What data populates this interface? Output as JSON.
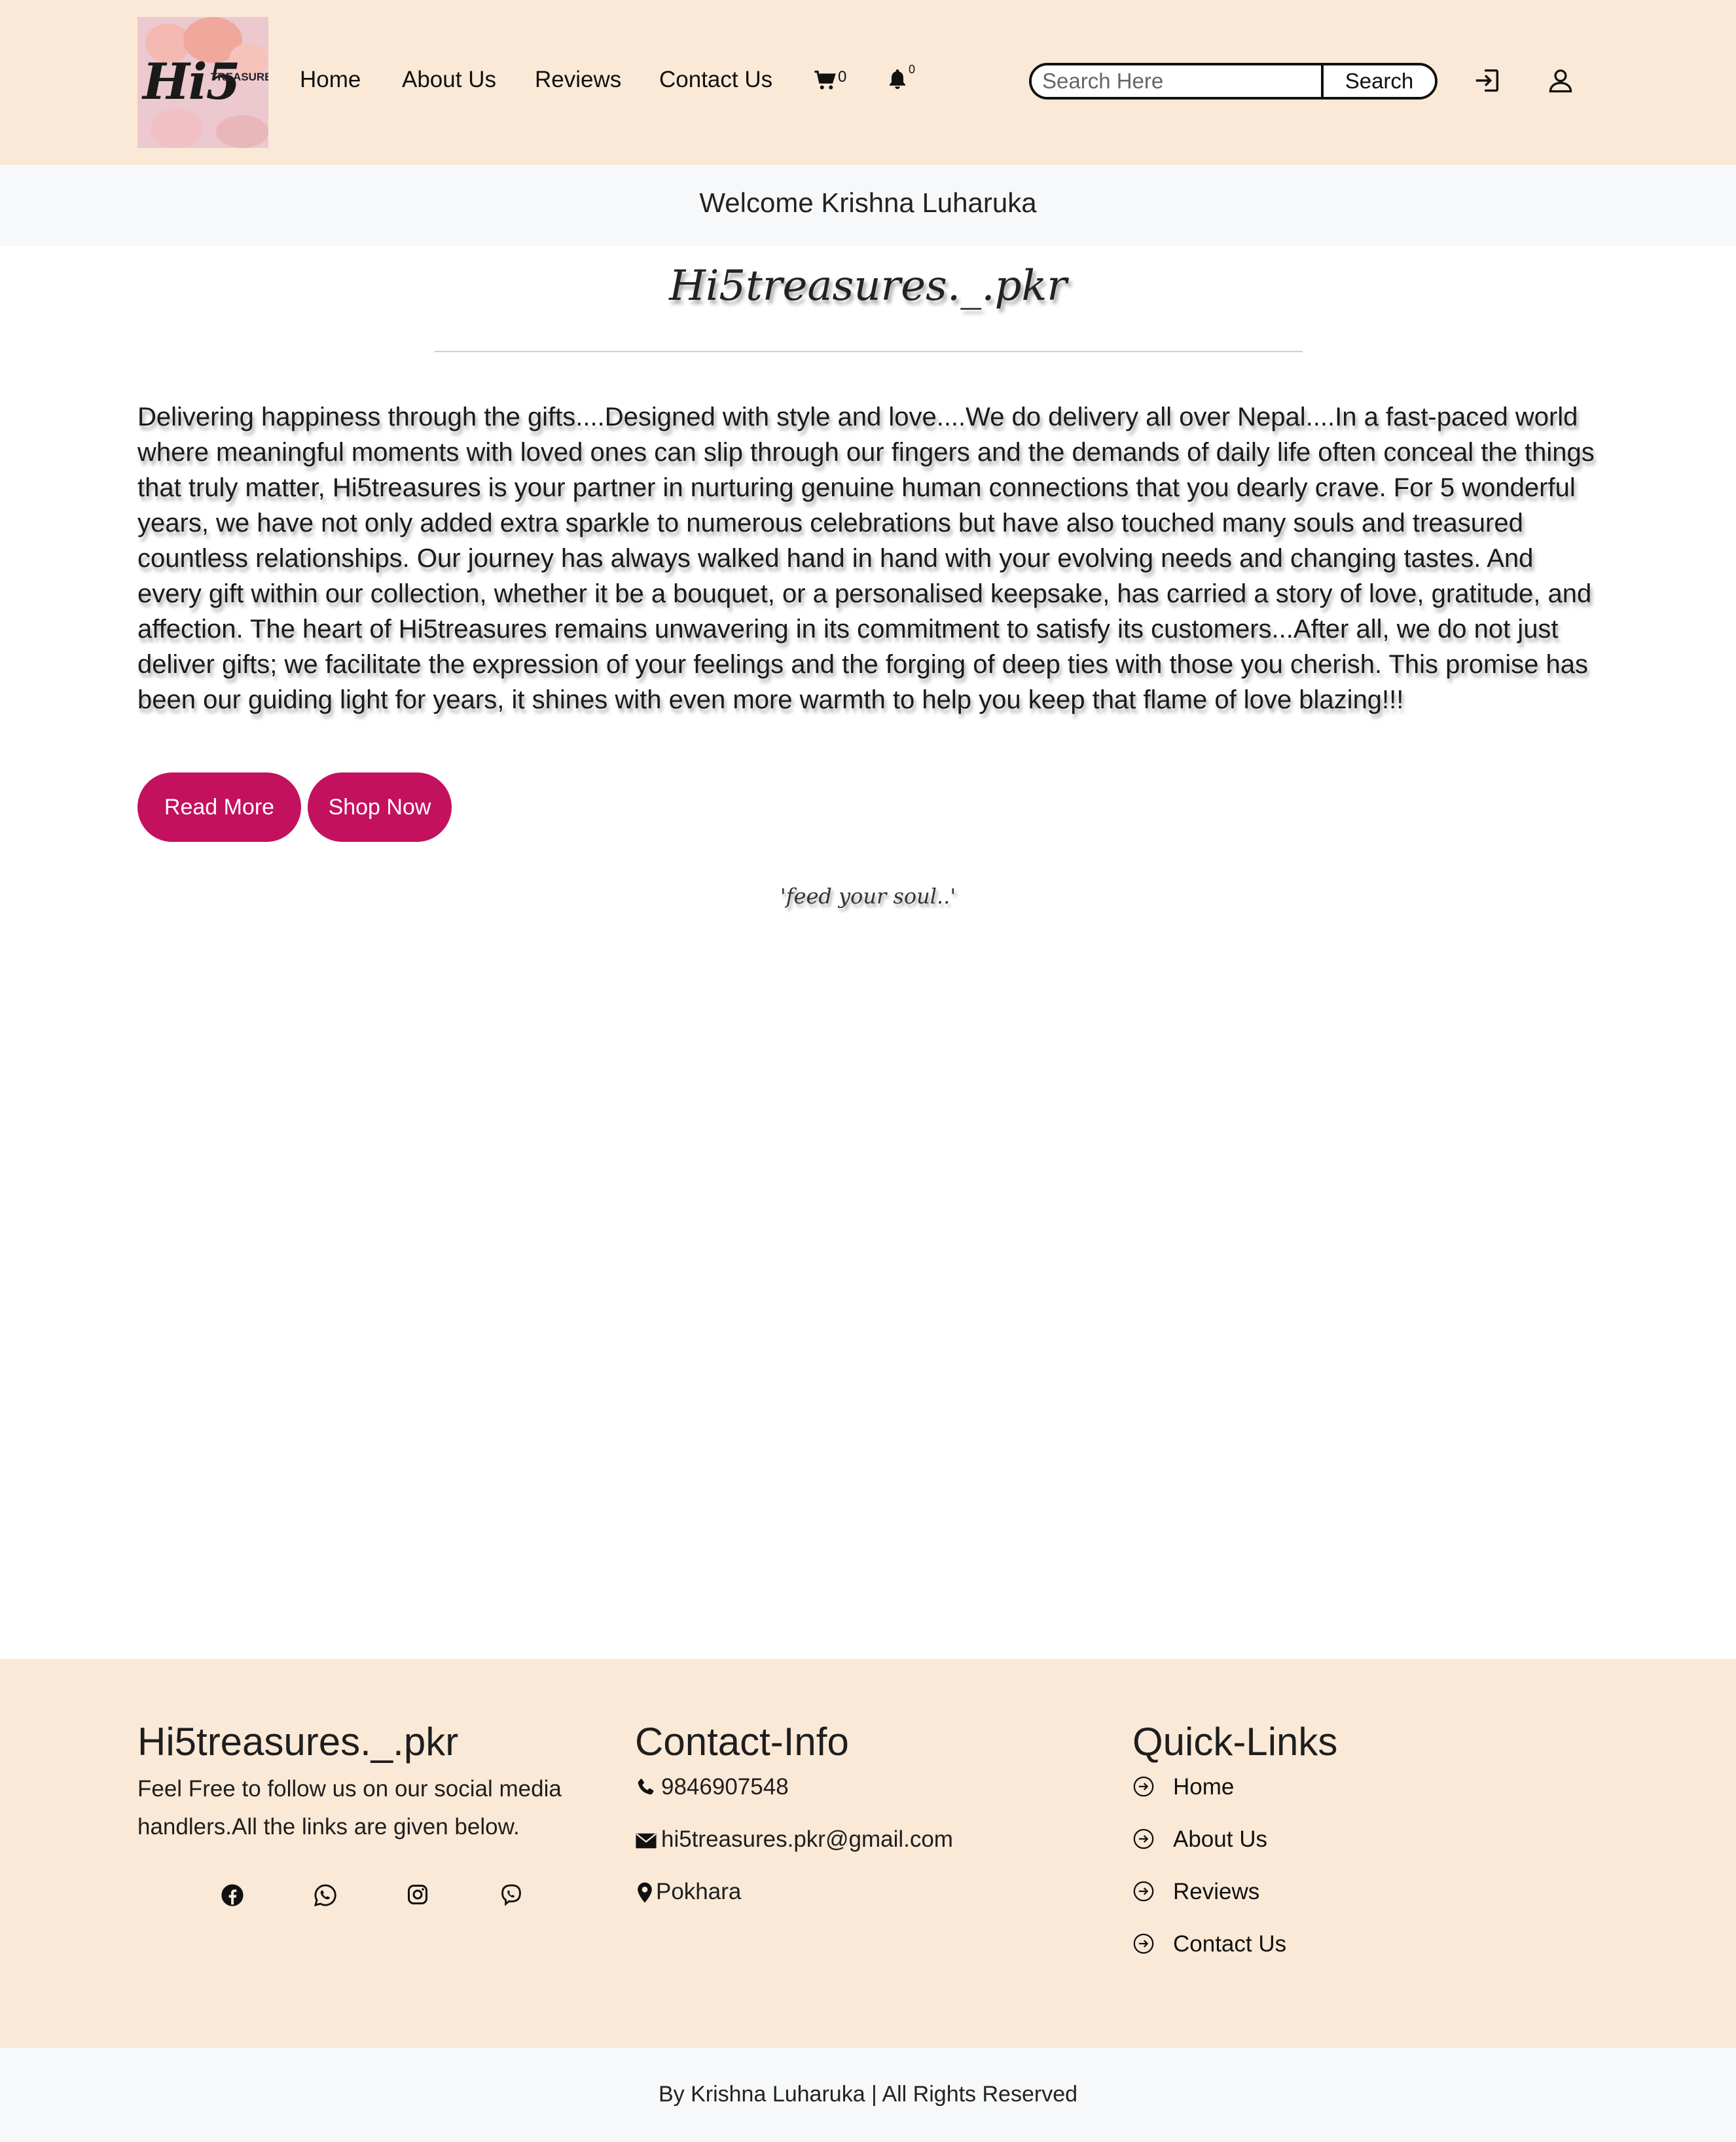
{
  "header": {
    "logo": {
      "main": "Hi5",
      "sub": "TREASURES"
    },
    "nav": [
      "Home",
      "About Us",
      "Reviews",
      "Contact Us"
    ],
    "cart_count": "0",
    "notification_count": "0",
    "search": {
      "placeholder": "Search Here",
      "button": "Search"
    },
    "icons": [
      "cart-icon",
      "bell-icon",
      "login-icon",
      "user-icon"
    ]
  },
  "welcome": "Welcome Krishna Luharuka",
  "main": {
    "brand_title": "Hi5treasures._.pkr",
    "intro": "Delivering happiness through the gifts....Designed with style and love....We do delivery all over Nepal....In a fast-paced world where meaningful moments with loved ones can slip through our fingers and the demands of daily life often conceal the things that truly matter, Hi5treasures is your partner in nurturing genuine human connections that you dearly crave. For 5 wonderful years, we have not only added extra sparkle to numerous celebrations but have also touched many souls and treasured countless relationships. Our journey has always walked hand in hand with your evolving needs and changing tastes. And every gift within our collection, whether it be a bouquet, or a personalised keepsake, has carried a story of love, gratitude, and affection. The heart of Hi5treasures remains unwavering in its commitment to satisfy its customers...After all, we do not just deliver gifts; we facilitate the expression of your feelings and the forging of deep ties with those you cherish. This promise has been our guiding light for years, it shines with even more warmth to help you keep that flame of love blazing!!!",
    "read_more": "Read More",
    "shop_now": "Shop Now",
    "tagline": "'feed your soul..'"
  },
  "footer": {
    "about": {
      "heading": "Hi5treasures._.pkr",
      "text": "Feel Free to follow us on our social media handlers.All the links are given below.",
      "socials": [
        "facebook-icon",
        "whatsapp-icon",
        "instagram-icon",
        "viber-icon"
      ]
    },
    "contact": {
      "heading": "Contact-Info",
      "phone": "9846907548",
      "email": "hi5treasures.pkr@gmail.com",
      "location": "Pokhara"
    },
    "quick_links": {
      "heading": "Quick-Links",
      "links": [
        "Home",
        "About Us",
        "Reviews",
        "Contact Us"
      ]
    },
    "copyright": "By Krishna Luharuka | All Rights Reserved"
  },
  "colors": {
    "header_bg": "#fae9d7",
    "accent_button": "#c4115d",
    "welcome_bg": "#f7f8f9"
  }
}
